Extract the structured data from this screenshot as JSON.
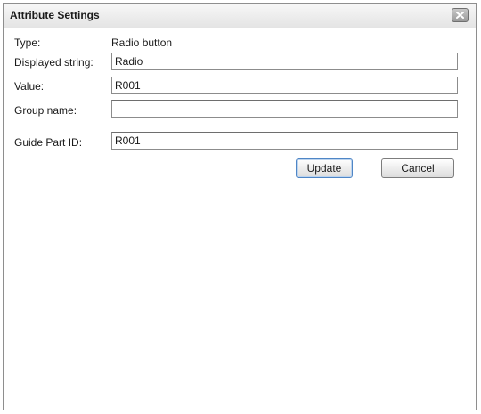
{
  "dialog": {
    "title": "Attribute Settings",
    "close_icon": "close-icon"
  },
  "form": {
    "type_label": "Type:",
    "type_value": "Radio button",
    "displayed_string_label": "Displayed string:",
    "displayed_string_value": "Radio",
    "value_label": "Value:",
    "value_value": "R001",
    "group_name_label": "Group name:",
    "group_name_value": "",
    "guide_part_id_label": "Guide Part ID:",
    "guide_part_id_value": "R001"
  },
  "buttons": {
    "update_label": "Update",
    "cancel_label": "Cancel"
  },
  "colors": {
    "title_bar": "#e8e8e8",
    "default_button_border": "#4f86c6",
    "dialog_border": "#8e8e8e"
  }
}
